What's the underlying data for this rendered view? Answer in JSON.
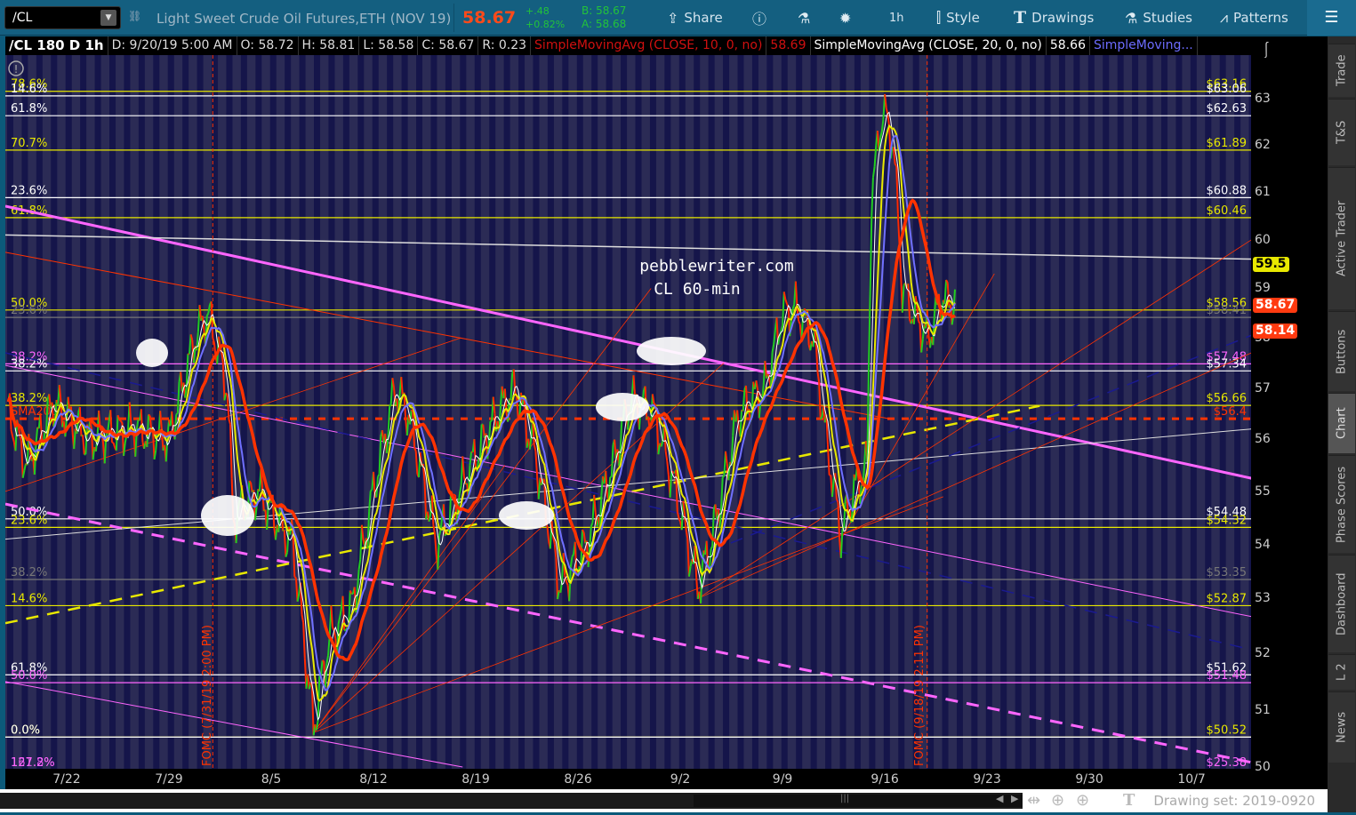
{
  "toolbar": {
    "symbol": "/CL",
    "description": "Light Sweet Crude Oil Futures,ETH (NOV 19)",
    "last": "58.67",
    "change": "+.48",
    "change_pct": "+0.82%",
    "bid": "B: 58.67",
    "ask": "A: 58.68",
    "share": "Share",
    "interval": "1h",
    "style": "Style",
    "drawings": "Drawings",
    "studies": "Studies",
    "patterns": "Patterns"
  },
  "header": {
    "title": "/CL 180 D 1h",
    "date": "D: 9/20/19 5:00 AM",
    "open": "O: 58.72",
    "high": "H: 58.81",
    "low": "L: 58.58",
    "close": "C: 58.67",
    "range": "R: 0.23",
    "sma10": "SimpleMovingAvg (CLOSE, 10, 0, no)",
    "sma10_val": "58.69",
    "sma20": "SimpleMovingAvg (CLOSE, 20, 0, no)",
    "sma20_val": "58.66",
    "sma3": "SimpleMoving..."
  },
  "colors": {
    "bg": "#2b2b55",
    "stripe": "#15154a",
    "yellow": "#e8e800",
    "magenta": "#ff66ff",
    "red": "#ff3300",
    "white": "#ffffff",
    "gray": "#777777",
    "blue": "#7070ff"
  },
  "annotations": {
    "site": "pebblewriter.com",
    "chart_name": "CL 60-min",
    "fomc1": "FOMC (7/31/19 2:00 PM)",
    "fomc2": "FOMC (9/18/19 2:11 PM)"
  },
  "chart_data": {
    "type": "line",
    "title": "/CL 180 D 1h",
    "x_unit": "days since 7/22/19",
    "y_scale": "log",
    "ylim": [
      50,
      63.4
    ],
    "xlim": [
      -4.2,
      81.1
    ],
    "y_ticks": [
      "63",
      "62",
      "61",
      "60",
      "59",
      "58",
      "57",
      "56",
      "55",
      "54",
      "53",
      "52",
      "51",
      "50"
    ],
    "x_ticks": [
      {
        "t": 0,
        "label": "7/22"
      },
      {
        "t": 7,
        "label": "7/29"
      },
      {
        "t": 14,
        "label": "8/5"
      },
      {
        "t": 21,
        "label": "8/12"
      },
      {
        "t": 28,
        "label": "8/19"
      },
      {
        "t": 35,
        "label": "8/26"
      },
      {
        "t": 42,
        "label": "9/2"
      },
      {
        "t": 49,
        "label": "9/9"
      },
      {
        "t": 56,
        "label": "9/16"
      },
      {
        "t": 63,
        "label": "9/23"
      },
      {
        "t": 70,
        "label": "9/30"
      },
      {
        "t": 77,
        "label": "10/7"
      }
    ],
    "price": [
      [
        -4.0,
        56.5
      ],
      [
        -2.7,
        55.5
      ],
      [
        -0.9,
        56.7
      ],
      [
        1.5,
        56.0
      ],
      [
        4.6,
        56.2
      ],
      [
        7.0,
        56.0
      ],
      [
        8.8,
        58.0
      ],
      [
        9.7,
        58.5
      ],
      [
        11.0,
        57.0
      ],
      [
        11.4,
        54.5
      ],
      [
        13.1,
        55.0
      ],
      [
        15.5,
        54.0
      ],
      [
        16.9,
        50.7
      ],
      [
        18.0,
        52.3
      ],
      [
        19.5,
        52.8
      ],
      [
        21.0,
        55.0
      ],
      [
        22.5,
        57.0
      ],
      [
        23.4,
        56.5
      ],
      [
        25.3,
        54.0
      ],
      [
        27.7,
        55.5
      ],
      [
        29.5,
        56.5
      ],
      [
        30.7,
        57.0
      ],
      [
        32.0,
        55.8
      ],
      [
        33.8,
        53.2
      ],
      [
        35.6,
        54.0
      ],
      [
        37.4,
        55.5
      ],
      [
        38.6,
        56.8
      ],
      [
        40.2,
        56.5
      ],
      [
        41.7,
        55.0
      ],
      [
        43.2,
        53.2
      ],
      [
        44.1,
        54.0
      ],
      [
        46.0,
        56.5
      ],
      [
        47.8,
        57.0
      ],
      [
        49.0,
        58.5
      ],
      [
        49.9,
        58.6
      ],
      [
        51.1,
        58.0
      ],
      [
        52.0,
        56.0
      ],
      [
        53.0,
        54.2
      ],
      [
        53.9,
        55.0
      ],
      [
        54.8,
        55.5
      ],
      [
        55.1,
        61.0
      ],
      [
        55.9,
        62.8
      ],
      [
        56.6,
        62.0
      ],
      [
        57.2,
        59.0
      ],
      [
        58.1,
        58.4
      ],
      [
        59.0,
        58.0
      ],
      [
        59.9,
        58.8
      ],
      [
        60.9,
        58.67
      ]
    ],
    "levels": [
      {
        "price": 63.16,
        "left": "78.6%",
        "right": "$63.16",
        "color": "#e8e800"
      },
      {
        "price": 63.06,
        "left": "14.6%",
        "right": "$63.06",
        "color": "#ffffff"
      },
      {
        "price": 62.63,
        "left": "61.8%",
        "right": "$62.63",
        "color": "#ffffff"
      },
      {
        "price": 61.89,
        "left": "70.7%",
        "right": "$61.89",
        "color": "#e8e800"
      },
      {
        "price": 60.88,
        "left": "23.6%",
        "right": "$60.88",
        "color": "#ffffff"
      },
      {
        "price": 60.46,
        "left": "61.8%",
        "right": "$60.46",
        "color": "#e8e800"
      },
      {
        "price": 58.56,
        "left": "50.0%",
        "right": "$58.56",
        "color": "#e8e800"
      },
      {
        "price": 58.41,
        "left": "23.6%",
        "right": "$58.41",
        "color": "#777777"
      },
      {
        "price": 57.48,
        "left": "38.2%",
        "right": "$57.48",
        "color": "#ff66ff"
      },
      {
        "price": 57.34,
        "left": "38.2%",
        "right": "$57.34",
        "color": "#ffffff"
      },
      {
        "price": 56.66,
        "left": "38.2%",
        "right": "$56.66",
        "color": "#e8e800"
      },
      {
        "price": 56.4,
        "left": "SMA200",
        "right": "$56.4",
        "color": "#ff3300",
        "dashed": true
      },
      {
        "price": 54.48,
        "left": "50.0%",
        "right": "$54.48",
        "color": "#ffffff"
      },
      {
        "price": 54.32,
        "left": "23.6%",
        "right": "$54.32",
        "color": "#e8e800"
      },
      {
        "price": 53.35,
        "left": "38.2%",
        "right": "$53.35",
        "color": "#777777"
      },
      {
        "price": 52.87,
        "left": "14.6%",
        "right": "$52.87",
        "color": "#e8e800"
      },
      {
        "price": 51.62,
        "left": "61.8%",
        "right": "$51.62",
        "color": "#ffffff"
      },
      {
        "price": 51.48,
        "left": "50.0%",
        "right": "$51.48",
        "color": "#ff66ff"
      },
      {
        "price": 50.52,
        "left": "0.0%",
        "right": "$50.52",
        "color": "#e8e800"
      },
      {
        "price": 50.52,
        "left": "0.0%",
        "right": "",
        "color": "#ffffff"
      }
    ],
    "offscale_labels": {
      "left1": "127.2%",
      "left2": "161.8%",
      "right": "$25.38"
    },
    "trendlines": [
      {
        "p": [
          -4.2,
          60.7,
          81.1,
          55.25
        ],
        "color": "#ff66ff",
        "w": 3
      },
      {
        "p": [
          -4.2,
          54.76,
          81.1,
          50.08
        ],
        "color": "#ff66ff",
        "w": 3,
        "dash": true
      },
      {
        "p": [
          -4.2,
          52.55,
          66.6,
          56.65
        ],
        "color": "#e8e800",
        "w": 2.5,
        "dash": true
      },
      {
        "p": [
          -4.2,
          60.1,
          81.1,
          59.6
        ],
        "color": "#dddddd",
        "w": 1.5
      },
      {
        "p": [
          -4.2,
          54.1,
          81.1,
          56.2
        ],
        "color": "#dddddd",
        "w": 1
      },
      {
        "p": [
          -4.2,
          57.45,
          81.1,
          52.67
        ],
        "color": "#ff66ff",
        "w": 1
      },
      {
        "p": [
          -4.2,
          51.5,
          27.1,
          50.0
        ],
        "color": "#ff66ff",
        "w": 1
      },
      {
        "p": [
          -4.2,
          57.7,
          81.1,
          52.07
        ],
        "color": "#1a1a90",
        "w": 1.5,
        "dash": true
      },
      {
        "p": [
          44.1,
          53.88,
          81.1,
          58.05
        ],
        "color": "#1a1a90",
        "w": 1.5,
        "dash": true
      },
      {
        "p": [
          -4.2,
          59.74,
          56.3,
          56.4
        ],
        "color": "#ff3300",
        "w": 1
      },
      {
        "p": [
          16.9,
          50.6,
          40,
          59
        ],
        "color": "#ff3300",
        "w": 0.8
      },
      {
        "p": [
          16.9,
          50.6,
          45,
          57.5
        ],
        "color": "#ff3300",
        "w": 0.8
      },
      {
        "p": [
          16.9,
          50.6,
          30,
          55.5
        ],
        "color": "#ff3300",
        "w": 0.8
      },
      {
        "p": [
          16.9,
          50.6,
          60,
          54.9
        ],
        "color": "#ff3300",
        "w": 0.8
      },
      {
        "p": [
          43.2,
          53.0,
          81.1,
          60.0
        ],
        "color": "#ff3300",
        "w": 0.8
      },
      {
        "p": [
          43.2,
          53.0,
          81.1,
          57.7
        ],
        "color": "#ff3300",
        "w": 0.8
      },
      {
        "p": [
          53.0,
          54.1,
          63.5,
          59.3
        ],
        "color": "#ff3300",
        "w": 0.8
      },
      {
        "p": [
          -4.2,
          55.0,
          27,
          58.0
        ],
        "color": "#ff3300",
        "w": 0.8
      }
    ],
    "fomc_t": [
      10.0,
      58.9
    ],
    "sma_periods": [
      {
        "n": 10,
        "color": "#ffffff",
        "w": 1
      },
      {
        "n": 20,
        "color": "#e8e800",
        "w": 2
      },
      {
        "n": 30,
        "color": "#7070ff",
        "w": 2
      },
      {
        "n": 60,
        "color": "#ff3300",
        "w": 3.5
      }
    ],
    "badges": [
      {
        "price": 59.5,
        "label": "59.5",
        "bg": "#e8e800",
        "fg": "#000"
      },
      {
        "price": 58.67,
        "label": "58.67",
        "bg": "#ff3a10",
        "fg": "#fff"
      },
      {
        "price": 58.14,
        "label": "58.14",
        "bg": "#ff3a10",
        "fg": "#fff"
      }
    ]
  },
  "sidebar": {
    "tabs": [
      "Trade",
      "T&S",
      "Active Trader",
      "Buttons",
      "Chart",
      "Phase Scores",
      "Dashboard",
      "L 2",
      "News"
    ],
    "active": "Chart"
  },
  "footer": {
    "drawing_set": "Drawing set: 2019-0920"
  }
}
